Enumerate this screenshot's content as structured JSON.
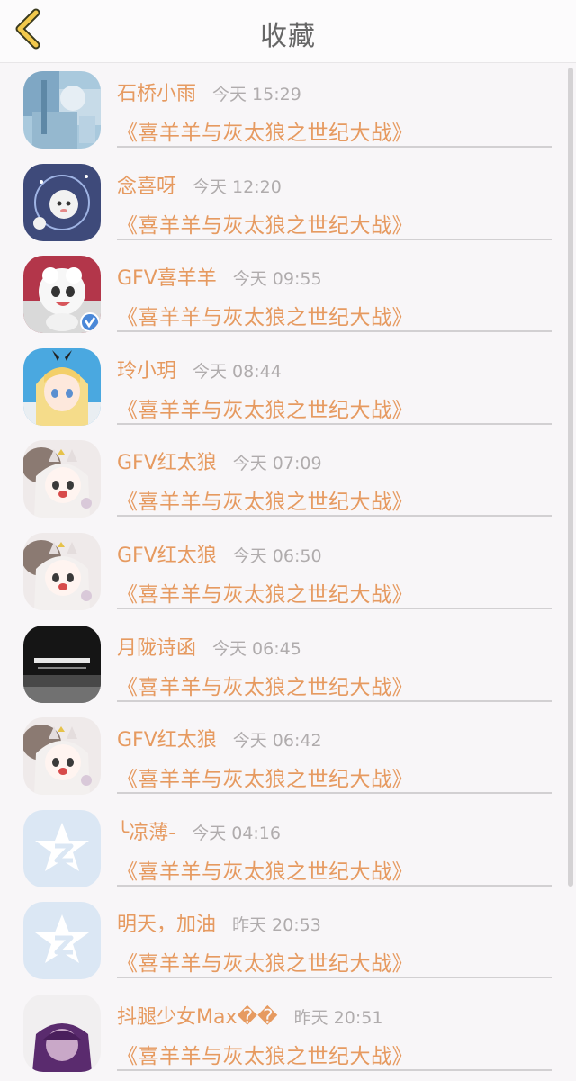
{
  "header": {
    "title": "收藏",
    "back_icon": "chevron-left-icon",
    "back_color": "#f2c94c"
  },
  "accent_color": "#e69a60",
  "items": [
    {
      "name": "石桥小雨",
      "time": "今天 15:29",
      "title": "《喜羊羊与灰太狼之世纪大战》",
      "avatar": "photo-blue"
    },
    {
      "name": "念喜呀",
      "time": "今天 12:20",
      "title": "《喜羊羊与灰太狼之世纪大战》",
      "avatar": "sheep-night"
    },
    {
      "name": "GFV喜羊羊",
      "time": "今天 09:55",
      "title": "《喜羊羊与灰太狼之世纪大战》",
      "avatar": "sheep-verified"
    },
    {
      "name": "玲小玥",
      "time": "今天 08:44",
      "title": "《喜羊羊与灰太狼之世纪大战》",
      "avatar": "anime-blonde"
    },
    {
      "name": "GFV红太狼",
      "time": "今天 07:09",
      "title": "《喜羊羊与灰太狼之世纪大战》",
      "avatar": "wolf-girl"
    },
    {
      "name": "GFV红太狼",
      "time": "今天 06:50",
      "title": "《喜羊羊与灰太狼之世纪大战》",
      "avatar": "wolf-girl"
    },
    {
      "name": "月陇诗函",
      "time": "今天 06:45",
      "title": "《喜羊羊与灰太狼之世纪大战》",
      "avatar": "dark-text"
    },
    {
      "name": "GFV红太狼",
      "time": "今天 06:42",
      "title": "《喜羊羊与灰太狼之世纪大战》",
      "avatar": "wolf-girl"
    },
    {
      "name": "╰凉薄-",
      "time": "今天 04:16",
      "title": "《喜羊羊与灰太狼之世纪大战》",
      "avatar": "qzone-default"
    },
    {
      "name": "明天，加油",
      "time": "昨天 20:53",
      "title": "《喜羊羊与灰太狼之世纪大战》",
      "avatar": "qzone-default"
    },
    {
      "name": "抖腿少女Max��",
      "time": "昨天 20:51",
      "title": "《喜羊羊与灰太狼之世纪大战》",
      "avatar": "purple-hair"
    }
  ]
}
